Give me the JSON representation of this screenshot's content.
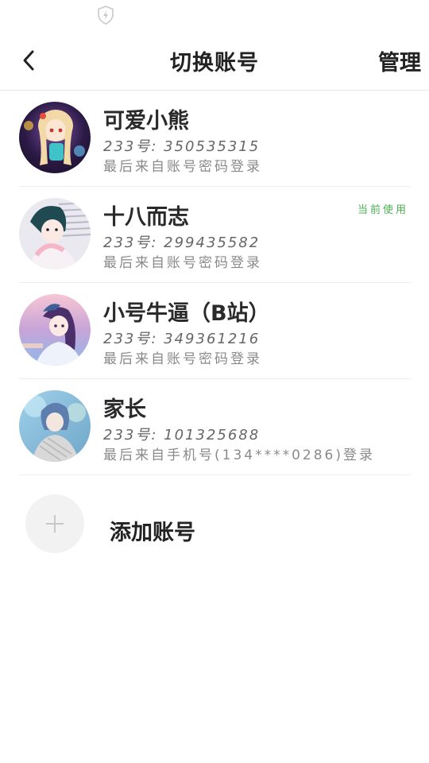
{
  "header": {
    "title": "切换账号",
    "manage_label": "管理"
  },
  "accounts": [
    {
      "name": "可爱小熊",
      "id_text": "233号: 350535315",
      "login_text": "最后来自账号密码登录",
      "current_label": ""
    },
    {
      "name": "十八而志",
      "id_text": "233号: 299435582",
      "login_text": "最后来自账号密码登录",
      "current_label": "当前使用"
    },
    {
      "name": "小号牛逼（B站）",
      "id_text": "233号: 349361216",
      "login_text": "最后来自账号密码登录",
      "current_label": ""
    },
    {
      "name": "家长",
      "id_text": "233号: 101325688",
      "login_text": "最后来自手机号(134****0286)登录",
      "current_label": ""
    }
  ],
  "add_account": {
    "label": "添加账号"
  },
  "colors": {
    "current_badge": "#4caf50",
    "divider": "#ececec",
    "add_circle": "#f2f2f2"
  },
  "icons": {
    "status": "shield-icon",
    "back": "chevron-left-icon",
    "add": "plus-icon"
  }
}
